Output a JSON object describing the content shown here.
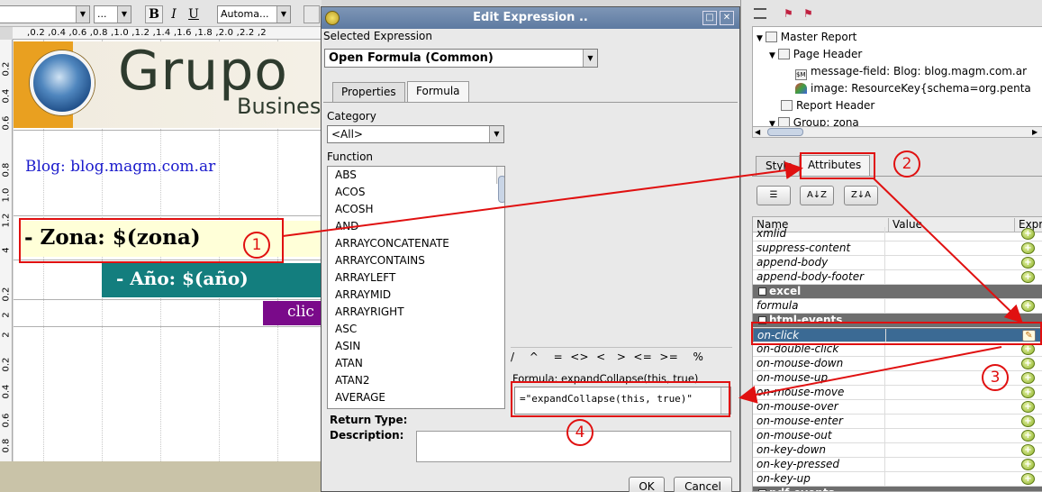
{
  "toolbar": {
    "font_size_value": "",
    "more_value": "...",
    "bold_label": "B",
    "italic_label": "I",
    "underline_label": "U",
    "auto_value": "Automa..."
  },
  "ruler": {
    "h_marks": ",0.2 ,0.4 ,0.6 ,0.8 ,1.0 ,1.2 ,1.4 ,1.6 ,1.8 ,2.0 ,2.2 ,2",
    "v_marks": [
      "0.2",
      "0.4",
      "0.6",
      "0.8",
      "1.0",
      "1.2",
      "4",
      "0.2",
      "2",
      "2",
      "0.2",
      "0.4",
      "0.6",
      "0.8",
      "0"
    ]
  },
  "report": {
    "logo_text": "Grupo",
    "logo_sub": "Busines",
    "blog_text": "Blog: blog.magm.com.ar",
    "zona_text": "- Zona: $(zona)",
    "anio_text": "- Año: $(año)",
    "clic_text": "clic"
  },
  "dialog": {
    "title": "Edit Expression ..",
    "selected_expression_label": "Selected Expression",
    "selected_expression_value": "Open Formula (Common)",
    "tabs": [
      "Properties",
      "Formula"
    ],
    "category_label": "Category",
    "category_value": "<All>",
    "function_label": "Function",
    "functions": [
      "ABS",
      "ACOS",
      "ACOSH",
      "AND",
      "ARRAYCONCATENATE",
      "ARRAYCONTAINS",
      "ARRAYLEFT",
      "ARRAYMID",
      "ARRAYRIGHT",
      "ASC",
      "ASIN",
      "ATAN",
      "ATAN2",
      "AVERAGE"
    ],
    "operators": "/    ^    =  <>  <   >  <=  >=    %",
    "formula_label": "Formula: expandCollapse(this, true)",
    "formula_value": "=\"expandCollapse(this, true)\"",
    "return_type_label": "Return Type:",
    "description_label": "Description:",
    "ok_label": "OK",
    "cancel_label": "Cancel"
  },
  "structure": {
    "tree": [
      {
        "label": "Master Report",
        "indent": 0
      },
      {
        "label": "Page Header",
        "indent": 1
      },
      {
        "label": "message-field: Blog: blog.magm.com.ar",
        "indent": 2
      },
      {
        "label": "image: ResourceKey{schema=org.penta",
        "indent": 2
      },
      {
        "label": "Report Header",
        "indent": 1
      },
      {
        "label": "Group: zona",
        "indent": 1
      }
    ],
    "tabs": [
      "Style",
      "Attributes"
    ],
    "columns": [
      "Name",
      "Value",
      "Expr"
    ],
    "rows": [
      {
        "name": "xmlid",
        "type": "attr"
      },
      {
        "name": "suppress-content",
        "type": "attr"
      },
      {
        "name": "append-body",
        "type": "attr"
      },
      {
        "name": "append-body-footer",
        "type": "attr"
      },
      {
        "name": "excel",
        "type": "group"
      },
      {
        "name": "formula",
        "type": "attr"
      },
      {
        "name": "html-events",
        "type": "group"
      },
      {
        "name": "on-click",
        "type": "selected"
      },
      {
        "name": "on-double-click",
        "type": "attr"
      },
      {
        "name": "on-mouse-down",
        "type": "attr"
      },
      {
        "name": "on-mouse-up",
        "type": "attr"
      },
      {
        "name": "on-mouse-move",
        "type": "attr"
      },
      {
        "name": "on-mouse-over",
        "type": "attr"
      },
      {
        "name": "on-mouse-enter",
        "type": "attr"
      },
      {
        "name": "on-mouse-out",
        "type": "attr"
      },
      {
        "name": "on-key-down",
        "type": "attr"
      },
      {
        "name": "on-key-pressed",
        "type": "attr"
      },
      {
        "name": "on-key-up",
        "type": "attr"
      },
      {
        "name": "pdf-events",
        "type": "group"
      }
    ]
  },
  "annotations": [
    "1",
    "2",
    "3",
    "4"
  ],
  "colors": {
    "annotation": "#e01010",
    "selected_row": "#3b6a94",
    "teal_band": "#137e7e",
    "purple_band": "#7a0a8a",
    "blog_link": "#1a1acc"
  }
}
